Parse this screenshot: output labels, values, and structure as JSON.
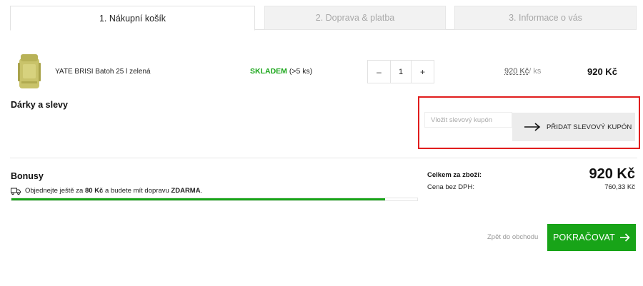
{
  "tabs": [
    {
      "label": "1. Nákupní košík",
      "active": true
    },
    {
      "label": "2. Doprava & platba",
      "active": false
    },
    {
      "label": "3. Informace o vás",
      "active": false
    }
  ],
  "cart": {
    "item": {
      "name": "YATE BRISI Batoh 25 l zelená",
      "stock_status": "SKLADEM",
      "stock_qty": "(>5 ks)",
      "quantity": "1",
      "qty_minus": "–",
      "qty_plus": "+",
      "unit_price": "920 Kč",
      "unit_suffix": "/ ks",
      "total": "920 Kč"
    }
  },
  "gifts": {
    "title": "Dárky a slevy",
    "coupon_placeholder": "Vložit slevový kupón",
    "coupon_button": "PŘIDAT SLEVOVÝ KUPÓN"
  },
  "bonus": {
    "title": "Bonusy",
    "text_prefix": "Objednejte ještě za",
    "amount": "80 Kč",
    "text_middle": "a budete mít dopravu",
    "free": "ZDARMA",
    "text_suffix": ".",
    "progress": 0.92
  },
  "summary": {
    "total_label": "Celkem za zboží:",
    "total_value": "920 Kč",
    "net_label": "Cena bez DPH:",
    "net_value": "760,33 Kč"
  },
  "actions": {
    "back": "Zpět do obchodu",
    "continue": "POKRAČOVAT"
  },
  "colors": {
    "accent_green": "#18a418",
    "highlight_red": "#e11d1d"
  },
  "icons": {
    "coupon_arrow": "arrow-right-icon",
    "truck": "truck-icon",
    "continue_arrow": "arrow-right-icon"
  }
}
